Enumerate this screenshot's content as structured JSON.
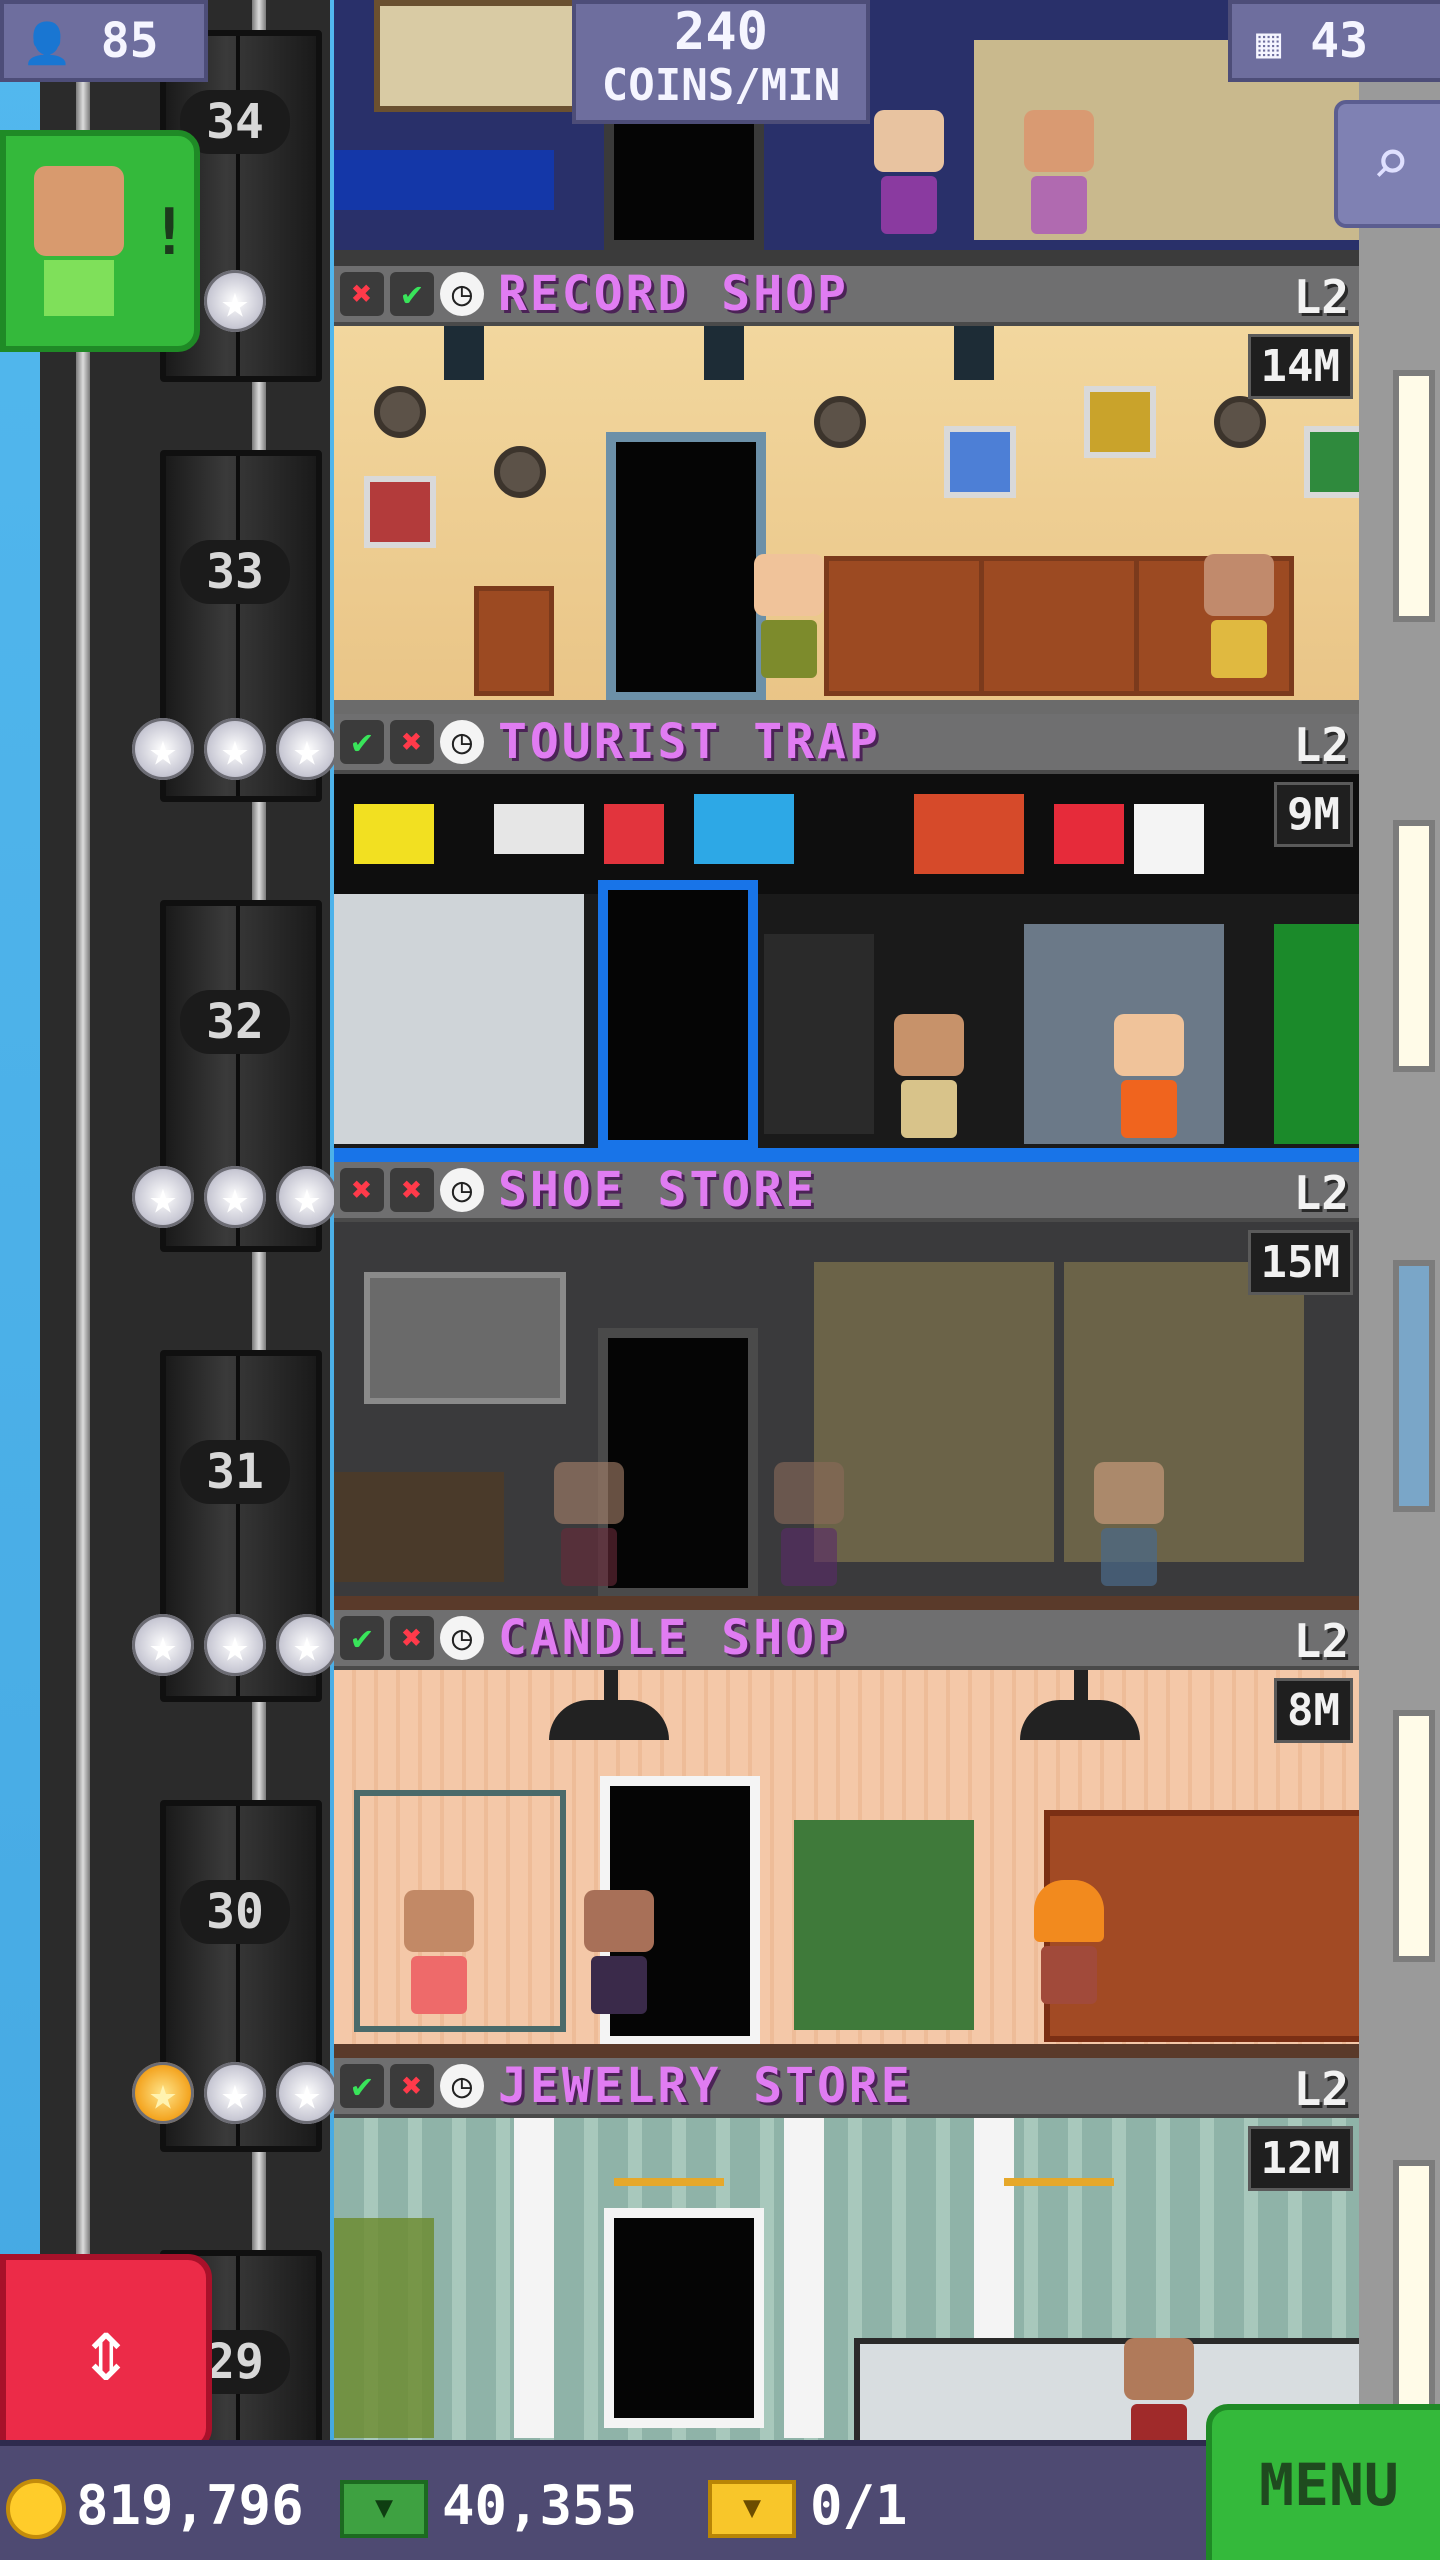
{
  "hud": {
    "population": "85",
    "coins_per_min_value": "240",
    "coins_per_min_label": "COINS/MIN",
    "floors_count": "43"
  },
  "shaft": {
    "floor_numbers": [
      "34",
      "33",
      "32",
      "31",
      "30",
      "29"
    ]
  },
  "floors": [
    {
      "name": "RECORD SHOP",
      "level": "L2",
      "earnings": "14M",
      "status": [
        "x",
        "check",
        "clock"
      ]
    },
    {
      "name": "TOURIST TRAP",
      "level": "L2",
      "earnings": "9M",
      "status": [
        "check",
        "x",
        "clock"
      ]
    },
    {
      "name": "SHOE STORE",
      "level": "L2",
      "earnings": "15M",
      "status": [
        "x",
        "x",
        "clock"
      ]
    },
    {
      "name": "CANDLE SHOP",
      "level": "L2",
      "earnings": "8M",
      "status": [
        "check",
        "x",
        "clock"
      ]
    },
    {
      "name": "JEWELRY STORE",
      "level": "L2",
      "earnings": "12M",
      "status": [
        "check",
        "x",
        "clock"
      ]
    }
  ],
  "bottom": {
    "coins": "819,796",
    "bux": "40,355",
    "tickets": "0/1",
    "menu_label": "MENU"
  },
  "icons": {
    "population": "person-icon",
    "floors": "building-grid-icon",
    "zoom": "magnifier-icon",
    "elevator": "up-down-arrows-icon",
    "coin": "coin-icon",
    "bux": "bux-icon",
    "ticket": "golden-ticket-icon"
  },
  "colors": {
    "shop_name": "#e07cf2",
    "menu_green": "#34b93b",
    "elevator_red": "#ec2b48",
    "hud_purple": "#6e6e9e"
  }
}
